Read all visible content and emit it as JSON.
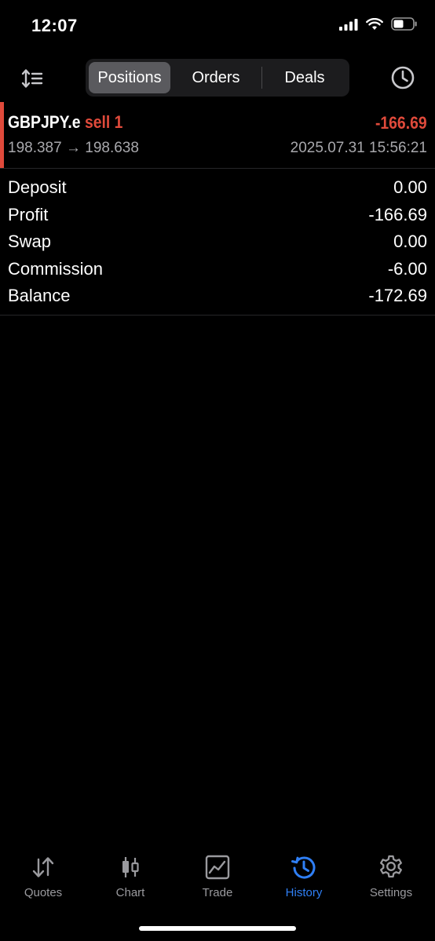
{
  "status_bar": {
    "time": "12:07"
  },
  "toolbar": {
    "segments": [
      "Positions",
      "Orders",
      "Deals"
    ],
    "active_segment": "Positions"
  },
  "position": {
    "symbol": "GBPJPY.e",
    "side": "sell 1",
    "profit": "-166.69",
    "open_price": "198.387",
    "arrow": "→",
    "close_price": "198.638",
    "timestamp": "2025.07.31 15:56:21"
  },
  "summary": [
    {
      "label": "Deposit",
      "value": "0.00"
    },
    {
      "label": "Profit",
      "value": "-166.69"
    },
    {
      "label": "Swap",
      "value": "0.00"
    },
    {
      "label": "Commission",
      "value": "-6.00"
    },
    {
      "label": "Balance",
      "value": "-172.69"
    }
  ],
  "tabs": [
    {
      "label": "Quotes",
      "icon": "quotes-arrows-icon"
    },
    {
      "label": "Chart",
      "icon": "candlestick-icon"
    },
    {
      "label": "Trade",
      "icon": "trade-chart-icon"
    },
    {
      "label": "History",
      "icon": "history-clock-icon",
      "active": true
    },
    {
      "label": "Settings",
      "icon": "gear-icon"
    }
  ],
  "colors": {
    "loss_red": "#e04a3b",
    "active_blue": "#2f7ff5",
    "inactive_gray": "#9a9a9e",
    "background": "#000000"
  }
}
